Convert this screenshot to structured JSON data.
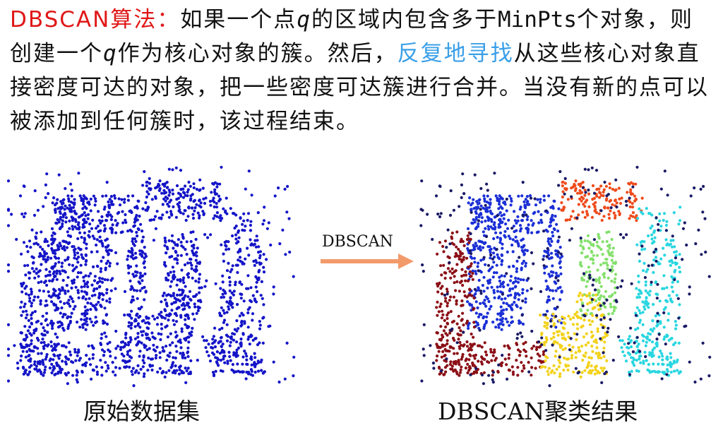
{
  "paragraph": {
    "term": "DBSCAN算法：",
    "t1": "如果一个点",
    "q1": "q",
    "t2": "的区域内包含多于",
    "minpts": "MinPts",
    "t3": "个对象，则创建一个",
    "q2": "q",
    "t4": "作为核心对象的簇。然后，",
    "highlight": "反复地寻找",
    "t5": "从这些核心对象直接密度可达的对象，把一些密度可达簇进行合并。当没有新的点可以被添加到任何簇时，该过程结束。"
  },
  "arrow_label": "DBSCAN",
  "captions": {
    "left": "原始数据集",
    "right": "DBSCAN聚类结果"
  },
  "colors": {
    "term": "#e01818",
    "highlight": "#3a9fe8",
    "arrow": "#f39a6b",
    "original_points": "#1414c8",
    "noise": "#1a1a66",
    "cluster_blue": "#1a2fd6",
    "cluster_darkred": "#8b0f16",
    "cluster_orange": "#ee4b1c",
    "cluster_green": "#84e06c",
    "cluster_yellow": "#f3d21a",
    "cluster_cyan": "#29d6e0"
  }
}
